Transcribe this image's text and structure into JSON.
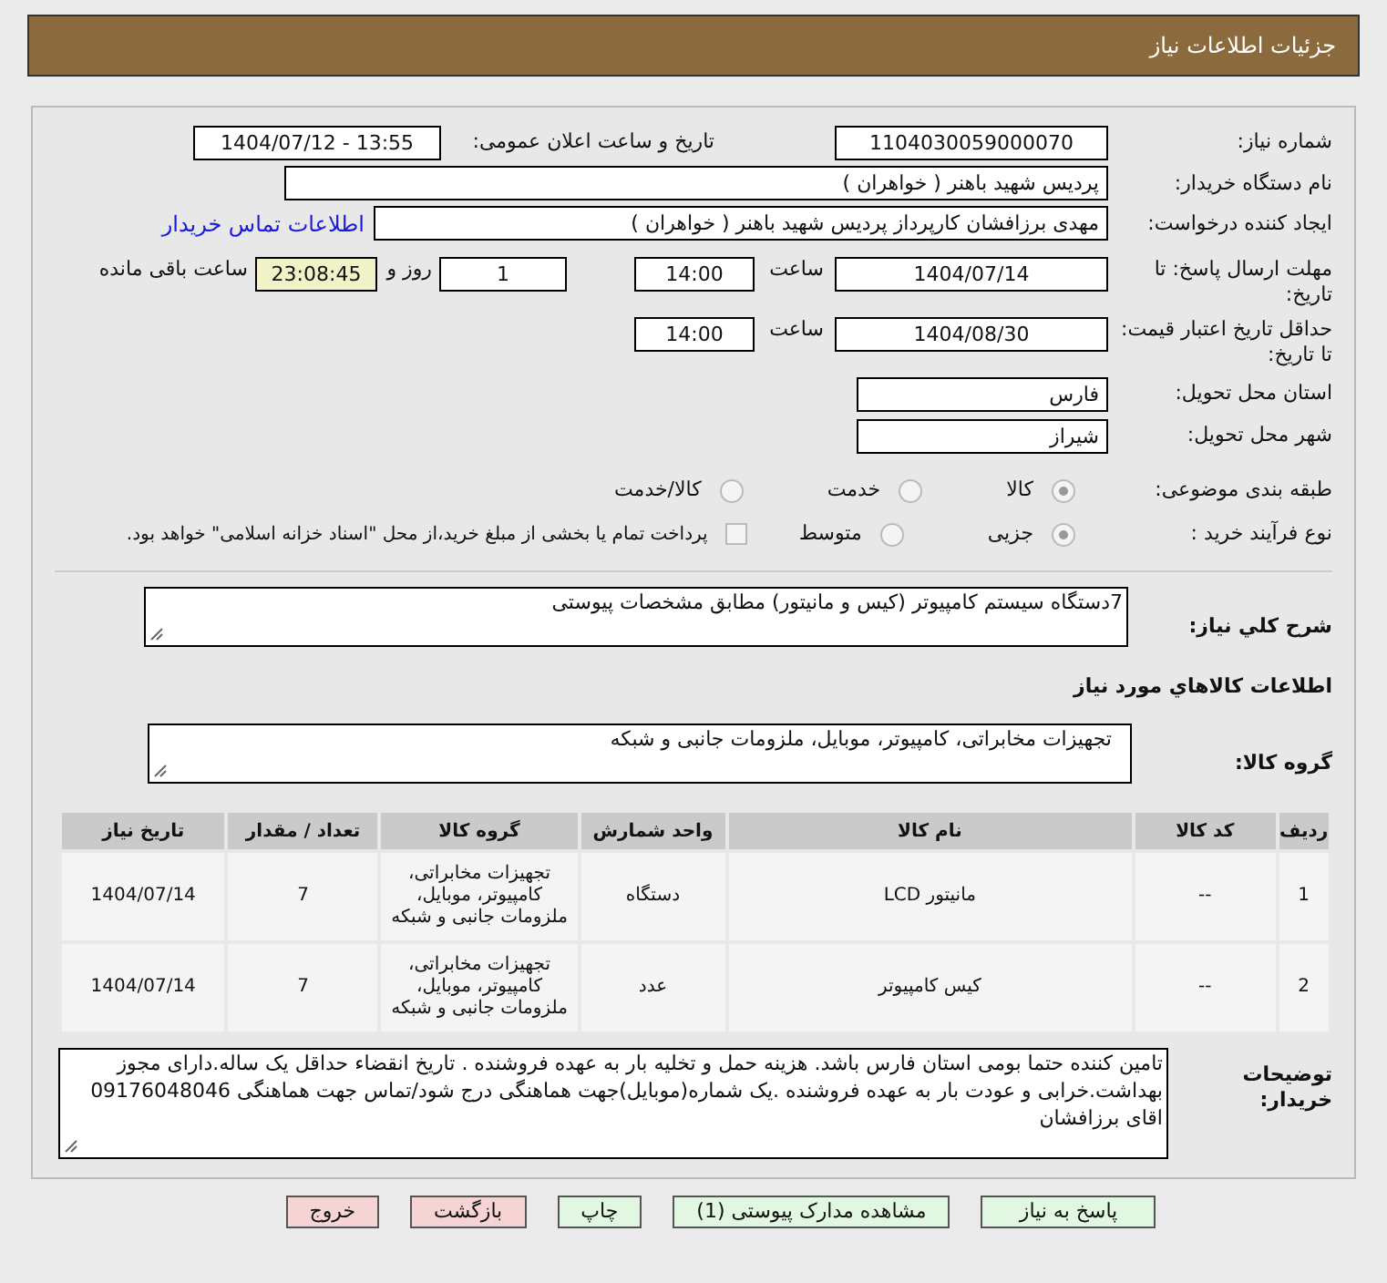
{
  "header": {
    "title": "جزئیات اطلاعات نیاز"
  },
  "need_number": {
    "label": "شماره نیاز:",
    "value": "1104030059000070"
  },
  "announce_datetime": {
    "label": "تاریخ و ساعت اعلان عمومی:",
    "value": "1404/07/12 - 13:55"
  },
  "buyer_org": {
    "label": "نام دستگاه خریدار:",
    "value": "پردیس شهید باهنر ( خواهران )"
  },
  "requester": {
    "label": "ایجاد کننده درخواست:",
    "value": "مهدی برزافشان کارپرداز پردیس شهید باهنر ( خواهران )",
    "link": "اطلاعات تماس خریدار"
  },
  "reply_deadline": {
    "label": "مهلت ارسال پاسخ: تا تاریخ:",
    "date": "1404/07/14",
    "time_label": "ساعت",
    "time": "14:00",
    "days": "1",
    "days_label": "روز و",
    "remaining": "23:08:45",
    "remaining_label": "ساعت باقی مانده"
  },
  "price_validity": {
    "label": "حداقل تاریخ اعتبار قیمت: تا تاریخ:",
    "date": "1404/08/30",
    "time_label": "ساعت",
    "time": "14:00"
  },
  "province": {
    "label": "استان محل تحویل:",
    "value": "فارس"
  },
  "city": {
    "label": "شهر محل تحویل:",
    "value": "شیراز"
  },
  "category": {
    "label": "طبقه بندی موضوعی:",
    "options": [
      {
        "label": "کالا",
        "selected": true
      },
      {
        "label": "خدمت",
        "selected": false
      },
      {
        "label": "کالا/خدمت",
        "selected": false
      }
    ]
  },
  "purchase_process": {
    "label": "نوع فرآیند خرید :",
    "options": [
      {
        "label": "جزیی",
        "selected": true
      },
      {
        "label": "متوسط",
        "selected": false
      }
    ],
    "payment_note": {
      "label": "پرداخت تمام یا بخشی از مبلغ خرید،از محل \"اسناد خزانه اسلامی\" خواهد بود.",
      "checked": false
    }
  },
  "general_description": {
    "label": "شرح کلي نیاز:",
    "value": "7دستگاه سیستم کامپیوتر (کیس و مانیتور) مطابق مشخصات پیوستی"
  },
  "goods_info_title": "اطلاعات كالاهاي مورد نياز",
  "goods_group": {
    "label": "گروه کالا:",
    "value": "تجهیزات مخابراتی، کامپیوتر، موبایل، ملزومات جانبی و شبکه"
  },
  "table": {
    "columns": [
      "ردیف",
      "کد کالا",
      "نام کالا",
      "واحد شمارش",
      "گروه کالا",
      "تعداد / مقدار",
      "تاریخ نیاز"
    ],
    "rows": [
      [
        "1",
        "--",
        "مانیتور LCD",
        "دستگاه",
        "تجهیزات مخابراتی، کامپیوتر، موبایل، ملزومات جانبی و شبکه",
        "7",
        "1404/07/14"
      ],
      [
        "2",
        "--",
        "کیس کامپیوتر",
        "عدد",
        "تجهیزات مخابراتی، کامپیوتر، موبایل، ملزومات جانبی و شبکه",
        "7",
        "1404/07/14"
      ]
    ]
  },
  "buyer_notes": {
    "label": "توضیحات خریدار:",
    "value": "تامین کننده حتما بومی استان فارس باشد. هزینه حمل و تخلیه بار به عهده فروشنده . تاریخ انقضاء حداقل یک ساله.دارای مجوز بهداشت.خرابی و عودت بار به عهده فروشنده  .یک شماره(موبایل)جهت هماهنگی درج شود/تماس جهت هماهنگی 09176048046 اقای برزافشان"
  },
  "buttons": [
    {
      "label": "پاسخ به نیاز",
      "kind": "action"
    },
    {
      "label": "مشاهده مدارک پیوستی (1)",
      "kind": "action"
    },
    {
      "label": "چاپ",
      "kind": "action"
    },
    {
      "label": "بازگشت",
      "kind": "danger"
    },
    {
      "label": "خروج",
      "kind": "danger"
    }
  ]
}
